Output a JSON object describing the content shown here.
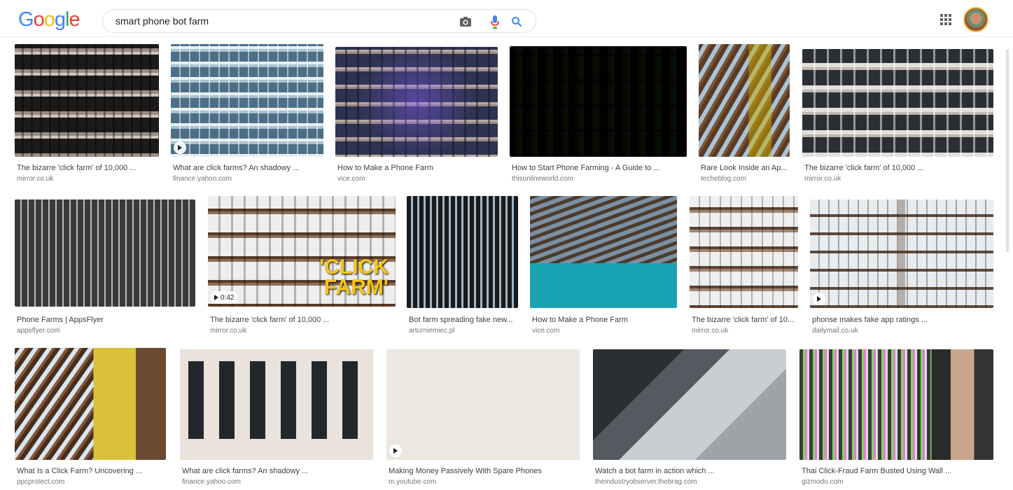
{
  "header": {
    "logo_letters": [
      {
        "ch": "G",
        "color": "#4285F4"
      },
      {
        "ch": "o",
        "color": "#EA4335"
      },
      {
        "ch": "o",
        "color": "#FBBC05"
      },
      {
        "ch": "g",
        "color": "#4285F4"
      },
      {
        "ch": "l",
        "color": "#34A853"
      },
      {
        "ch": "e",
        "color": "#EA4335"
      }
    ],
    "search_query": "smart phone bot farm",
    "icons": [
      "camera-icon",
      "microphone-icon",
      "search-icon",
      "apps-grid-icon",
      "avatar"
    ]
  },
  "results": [
    {
      "title": "The bizarre 'click farm' of 10,000 ...",
      "domain": "mirror.co.uk"
    },
    {
      "title": "What are click farms? An shadowy ...",
      "domain": "finance.yahoo.com",
      "badge": ""
    },
    {
      "title": "How to Make a Phone Farm",
      "domain": "vice.com"
    },
    {
      "title": "How to Start Phone Farming - A Guide to ...",
      "domain": "thisonlineworld.com"
    },
    {
      "title": "Rare Look Inside an Ap...",
      "domain": "techeblog.com"
    },
    {
      "title": "The bizarre 'click farm' of 10,000 ...",
      "domain": "mirror.co.uk"
    },
    {
      "title": "Phone Farms | AppsFlyer",
      "domain": "appsflyer.com"
    },
    {
      "title": "The bizarre 'click farm' of 10,000 ...",
      "domain": "mirror.co.uk",
      "badge": "0:42",
      "overlay": "'CLICK FARM'"
    },
    {
      "title": "Bot farm spreading fake new...",
      "domain": "arturniemiec.pl"
    },
    {
      "title": "How to Make a Phone Farm",
      "domain": "vice.com"
    },
    {
      "title": "The bizarre 'click farm' of 10...",
      "domain": "mirror.co.uk"
    },
    {
      "title": "phonse makes fake app ratings ...",
      "domain": "dailymail.co.uk",
      "badge": ""
    },
    {
      "title": "What Is a Click Farm? Uncovering ...",
      "domain": "ppcprotect.com"
    },
    {
      "title": "What are click farms? An shadowy ...",
      "domain": "finance.yahoo.com"
    },
    {
      "title": "Making Money Passively With Spare Phones",
      "domain": "m.youtube.com",
      "badge": ""
    },
    {
      "title": "Watch a bot farm in action which ...",
      "domain": "theindustryobserver.thebrag.com"
    },
    {
      "title": "Thai Click-Fraud Farm Busted Using Wall ...",
      "domain": "gizmodo.com"
    }
  ]
}
